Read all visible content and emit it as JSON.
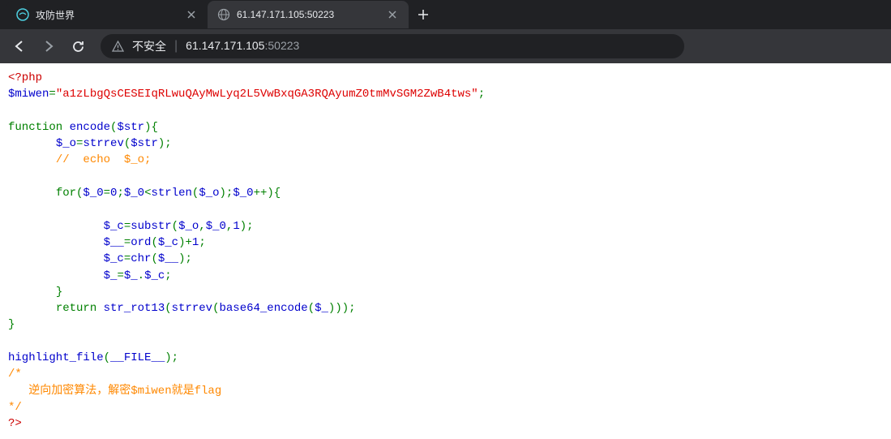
{
  "tabs": [
    {
      "title": "攻防世界",
      "active": false
    },
    {
      "title": "61.147.171.105:50223",
      "active": true
    }
  ],
  "addressBar": {
    "securityLabel": "不安全",
    "urlHost": "61.147.171.105",
    "urlPort": ":50223"
  },
  "code": {
    "l1_open": "<?php",
    "l2_var": "$miwen",
    "l2_eq": "=",
    "l2_str": "\"a1zLbgQsCESEIqRLwuQAyMwLyq2L5VwBxqGA3RQAyumZ0tmMvSGM2ZwB4tws\"",
    "l2_semi": ";",
    "l3_func": "function ",
    "l3_name": "encode",
    "l3_p1": "(",
    "l3_param": "$str",
    "l3_p2": "){",
    "l4_var": "$_o",
    "l4_eq": "=",
    "l4_fn": "strrev",
    "l4_p1": "(",
    "l4_arg": "$str",
    "l4_p2": ");",
    "l5_comment": "//  echo  $_o;",
    "l6_for": "for(",
    "l6_v1": "$_0",
    "l6_eq1": "=",
    "l6_zero": "0",
    "l6_semi1": ";",
    "l6_v2": "$_0",
    "l6_lt": "<",
    "l6_fn": "strlen",
    "l6_p1": "(",
    "l6_arg": "$_o",
    "l6_p2": ");",
    "l6_v3": "$_0",
    "l6_inc": "++){",
    "l7_v": "$_c",
    "l7_eq": "=",
    "l7_fn": "substr",
    "l7_p1": "(",
    "l7_a1": "$_o",
    "l7_c1": ",",
    "l7_a2": "$_0",
    "l7_c2": ",",
    "l7_one": "1",
    "l7_p2": ");",
    "l8_v": "$__",
    "l8_eq": "=",
    "l8_fn": "ord",
    "l8_p1": "(",
    "l8_a": "$_c",
    "l8_p2": ")+",
    "l8_one": "1",
    "l8_semi": ";",
    "l9_v": "$_c",
    "l9_eq": "=",
    "l9_fn": "chr",
    "l9_p1": "(",
    "l9_a": "$__",
    "l9_p2": ");",
    "l10_v1": "$_",
    "l10_eq": "=",
    "l10_v2": "$_",
    "l10_dot": ".",
    "l10_v3": "$_c",
    "l10_semi": ";",
    "l11_cb": "}",
    "l12_ret": "return ",
    "l12_fn1": "str_rot13",
    "l12_p1": "(",
    "l12_fn2": "strrev",
    "l12_p2": "(",
    "l12_fn3": "base64_encode",
    "l12_p3": "(",
    "l12_a": "$_",
    "l12_p4": ")));",
    "l13_cb": "}",
    "l14_fn": "highlight_file",
    "l14_p1": "(",
    "l14_a": "__FILE__",
    "l14_p2": ");",
    "l15_open": "/*",
    "l16_comment": "   逆向加密算法，解密$miwen就是flag",
    "l17_close": "*/",
    "l18_close": "?>"
  }
}
